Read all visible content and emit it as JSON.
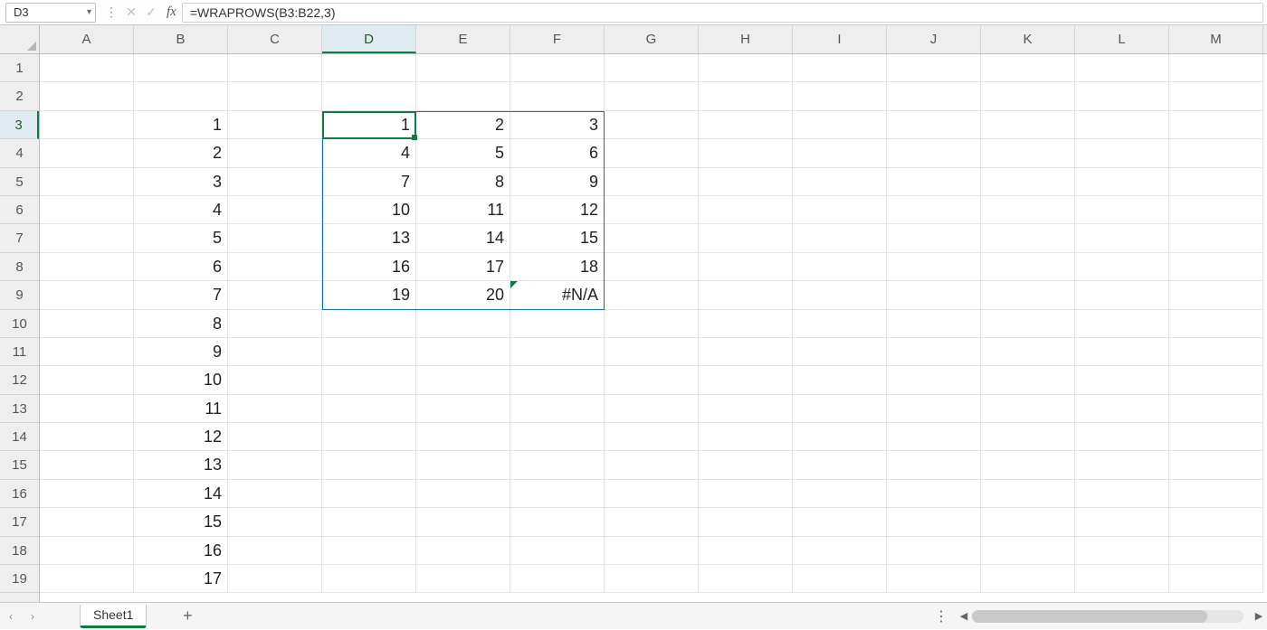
{
  "formula_bar": {
    "cell_ref": "D3",
    "formula": "=WRAPROWS(B3:B22,3)"
  },
  "columns": [
    "A",
    "B",
    "C",
    "D",
    "E",
    "F",
    "G",
    "H",
    "I",
    "J",
    "K",
    "L",
    "M"
  ],
  "active_column": "D",
  "row_count": 19,
  "active_row": 3,
  "cells": {
    "B3": "1",
    "B4": "2",
    "B5": "3",
    "B6": "4",
    "B7": "5",
    "B8": "6",
    "B9": "7",
    "B10": "8",
    "B11": "9",
    "B12": "10",
    "B13": "11",
    "B14": "12",
    "B15": "13",
    "B16": "14",
    "B17": "15",
    "B18": "16",
    "B19": "17",
    "D3": "1",
    "E3": "2",
    "F3": "3",
    "D4": "4",
    "E4": "5",
    "F4": "6",
    "D5": "7",
    "E5": "8",
    "F5": "9",
    "D6": "10",
    "E6": "11",
    "F6": "12",
    "D7": "13",
    "E7": "14",
    "F7": "15",
    "D8": "16",
    "E8": "17",
    "F8": "18",
    "D9": "19",
    "E9": "20",
    "F9": "#N/A"
  },
  "error_cells": [
    "F9"
  ],
  "sheets": {
    "active": "Sheet1"
  },
  "icons": {
    "dropdown": "▾",
    "more": "⋮",
    "cancel": "✕",
    "enter": "✓",
    "fx": "fx",
    "prev": "‹",
    "next": "›",
    "add": "+",
    "left": "◀",
    "right": "▶"
  }
}
